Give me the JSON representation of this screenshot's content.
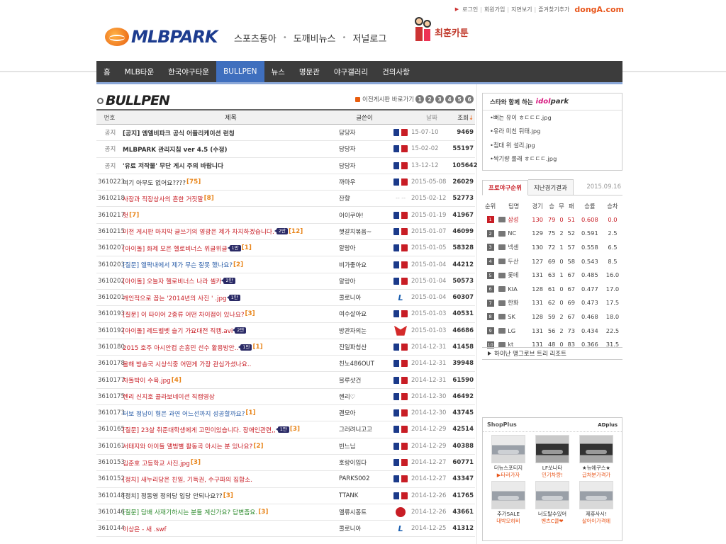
{
  "top_links": {
    "items": [
      "로그인",
      "회원가입",
      "지면보기",
      "즐겨찾기추가"
    ],
    "brand": "dongA.com"
  },
  "header": {
    "logo": "MLBPARK",
    "site_nav": [
      "스포츠동아",
      "도깨비뉴스",
      "저널로그"
    ],
    "cartoon": "최훈카툰"
  },
  "main_nav": {
    "items": [
      "홈",
      "MLB타운",
      "한국야구타운",
      "BULLPEN",
      "뉴스",
      "명문관",
      "야구갤러리",
      "건의사항"
    ],
    "active": "BULLPEN"
  },
  "board": {
    "title": "BULLPEN",
    "prev_label": "이전게시판 바로가기",
    "pages": [
      "1",
      "2",
      "3",
      "4",
      "5",
      "6"
    ],
    "columns": {
      "num": "번호",
      "title": "제목",
      "writer": "글쓴이",
      "date": "날짜",
      "views": "조회"
    },
    "rows": [
      {
        "num": "공지",
        "title": "[공지] 엠엘비파크 공식 어플리케이션 런칭",
        "comments": "",
        "tag": "",
        "writer": "담당자",
        "team": "mlb",
        "date": "15-07-10",
        "views": "9469",
        "color": "dark",
        "notice": true
      },
      {
        "num": "공지",
        "title": "MLBPARK 관리지침 ver 4.5 (수정)",
        "comments": "",
        "tag": "",
        "writer": "담당자",
        "team": "mlb",
        "date": "15-02-02",
        "views": "55197",
        "color": "dark",
        "notice": true
      },
      {
        "num": "공지",
        "title": "'유료 저작물' 무단 게시 주의 바랍니다",
        "comments": "",
        "tag": "",
        "writer": "담당자",
        "team": "mlb",
        "date": "13-12-12",
        "views": "105642",
        "color": "dark",
        "notice": true
      },
      {
        "num": "3610223",
        "title": "여기 아무도 없어요????",
        "comments": "[75]",
        "tag": "",
        "writer": "까마우",
        "team": "mlb",
        "date": "2015-05-08",
        "views": "26029",
        "color": "dark",
        "notice": false
      },
      {
        "num": "3610218",
        "title": "사장과 직장상사의 흔한 거짓말",
        "comments": "[8]",
        "tag": "",
        "writer": "잔향",
        "team": "none",
        "date": "2015-02-12",
        "views": "52773",
        "color": "red",
        "notice": false
      },
      {
        "num": "3610217",
        "title": "헛",
        "comments": "[7]",
        "tag": "",
        "writer": "어이쿠야!",
        "team": "mlb",
        "date": "2015-01-19",
        "views": "41967",
        "color": "red",
        "notice": false
      },
      {
        "num": "3610215",
        "title": "이전 게시판 마지막 글쓰기의 영광은 제가 차지하겠습니다.",
        "comments": "[12]",
        "tag": "2만",
        "writer": "햇갈치볶음~",
        "team": "mlb",
        "date": "2015-01-07",
        "views": "46099",
        "color": "red",
        "notice": false
      },
      {
        "num": "3610207",
        "title": "[아이돌] 화제 모은 헬로비너스 위글위글",
        "comments": "[1]",
        "tag": "1만",
        "writer": "알랑아",
        "team": "mlb",
        "date": "2015-01-05",
        "views": "58328",
        "color": "red",
        "notice": false
      },
      {
        "num": "3610203",
        "title": "[질문] 앨팍내에서 제가 무슨 잘못 했나요?",
        "comments": "[2]",
        "tag": "",
        "writer": "비가좋아요",
        "team": "mlb",
        "date": "2015-01-04",
        "views": "44212",
        "color": "blue",
        "notice": false
      },
      {
        "num": "3610202",
        "title": "[아이돌] 오늘자 헬로비너스 나라 셀카",
        "comments": "",
        "tag": "2만",
        "writer": "알랑아",
        "team": "mlb",
        "date": "2015-01-04",
        "views": "50573",
        "color": "red",
        "notice": false
      },
      {
        "num": "3610201",
        "title": "개인적으로 꼽는 '2014년의 사진 ' .jpg",
        "comments": "",
        "tag": "1만",
        "writer": "콜로니아",
        "team": "la",
        "date": "2015-01-04",
        "views": "60307",
        "color": "red",
        "notice": false
      },
      {
        "num": "3610193",
        "title": "[질문] 이 타이어 2종류 어떤 차이점이 있나요?",
        "comments": "[3]",
        "tag": "",
        "writer": "여수살아요",
        "team": "mlb",
        "date": "2015-01-03",
        "views": "40531",
        "color": "red",
        "notice": false
      },
      {
        "num": "3610192",
        "title": "[아이돌] 레드벨벳 슬기 가요대전 직캠.avi",
        "comments": "",
        "tag": "2만",
        "writer": "방관자의눈",
        "team": "kbo",
        "date": "2015-01-03",
        "views": "46686",
        "color": "red",
        "notice": false
      },
      {
        "num": "3610180",
        "title": "2015 호주 아시안컵 손흥민 선수 활용방안..",
        "comments": "[1]",
        "tag": "1만",
        "writer": "진일파청산",
        "team": "mlb",
        "date": "2014-12-31",
        "views": "41458",
        "color": "red",
        "notice": false
      },
      {
        "num": "3610178",
        "title": "올해 방송국 시상식중 어떤게 가장 관심가셨나요..",
        "comments": "",
        "tag": "",
        "writer": "친노486OUT",
        "team": "mlb",
        "date": "2014-12-31",
        "views": "39948",
        "color": "red",
        "notice": false
      },
      {
        "num": "3610177",
        "title": "차돌박이 수육.jpg",
        "comments": "[4]",
        "tag": "",
        "writer": "블루샷건",
        "team": "mlb",
        "date": "2014-12-31",
        "views": "61590",
        "color": "red",
        "notice": false
      },
      {
        "num": "3610175",
        "title": "헨리 신지호 콜라보네이션 직캠영상",
        "comments": "",
        "tag": "",
        "writer": "헨리♡",
        "team": "mlb",
        "date": "2014-12-30",
        "views": "46492",
        "color": "red",
        "notice": false
      },
      {
        "num": "3610173",
        "title": "터보 정남이 형은 과연 어느선까지 성공할까요?",
        "comments": "[1]",
        "tag": "",
        "writer": "괜모아",
        "team": "mlb",
        "date": "2014-12-30",
        "views": "43745",
        "color": "blue",
        "notice": false
      },
      {
        "num": "3610165",
        "title": "[질문] 23살 취준대학생에게 고민이있습니다. 장애인관련,,",
        "comments": "[3]",
        "tag": "1만",
        "writer": "그러려니고고",
        "team": "mlb",
        "date": "2014-12-29",
        "views": "42514",
        "color": "red",
        "notice": false
      },
      {
        "num": "3610161",
        "title": "서태지와 아이들 앨범별 활동곡 아시는 분 있나요?",
        "comments": "[2]",
        "tag": "",
        "writer": "빈느님",
        "team": "mlb",
        "date": "2014-12-29",
        "views": "40388",
        "color": "red",
        "notice": false
      },
      {
        "num": "3610153",
        "title": "김준호 고등학교 사진.jpg",
        "comments": "[3]",
        "tag": "",
        "writer": "호랑이임다",
        "team": "mlb",
        "date": "2014-12-27",
        "views": "60771",
        "color": "red",
        "notice": false
      },
      {
        "num": "3610152",
        "title": "[정치] 새누리당은 친일, 기득권, 수구파의 집합소.",
        "comments": "",
        "tag": "",
        "writer": "PARKS002",
        "team": "mlb",
        "date": "2014-12-27",
        "views": "43347",
        "color": "red",
        "notice": false
      },
      {
        "num": "3610148",
        "title": "[정치] 정동영 정의당 입당 안되나요??",
        "comments": "[3]",
        "tag": "",
        "writer": "TTANK",
        "team": "mlb",
        "date": "2014-12-26",
        "views": "41765",
        "color": "dark",
        "notice": false
      },
      {
        "num": "3610146",
        "title": "[질문] 담배 사재기하시는 분들 계신가요? 답변좀요.",
        "comments": "[3]",
        "tag": "",
        "writer": "엘류시퐁트",
        "team": "cle",
        "date": "2014-12-26",
        "views": "43661",
        "color": "green",
        "notice": false
      },
      {
        "num": "3610144",
        "title": "이상은 - 새 .swf",
        "comments": "",
        "tag": "",
        "writer": "콜로니아",
        "team": "la",
        "date": "2014-12-25",
        "views": "41312",
        "color": "red",
        "notice": false
      }
    ]
  },
  "idol": {
    "header_prefix": "스타와 함께 하는",
    "brand_a": "idol",
    "brand_b": "park",
    "items": [
      "•뻐는 유이 ㅎㄷㄷㄷ.jpg",
      "•유라 미친 뒤태.jpg",
      "•침대 위 설리.jpg",
      "•싹기량 롤래 ㅎㄷㄷㄷ.jpg"
    ]
  },
  "ranking": {
    "tab_active": "프로야구순위",
    "tab_other": "지난경기결과",
    "date": "2015.09.16",
    "headers": [
      "순위",
      "팀명",
      "경기",
      "승",
      "무",
      "패",
      "승률",
      "승차"
    ],
    "rows": [
      {
        "rank": "1",
        "team": "삼성",
        "g": "130",
        "w": "79",
        "d": "0",
        "l": "51",
        "pct": "0.608",
        "gb": "0.0"
      },
      {
        "rank": "2",
        "team": "NC",
        "g": "129",
        "w": "75",
        "d": "2",
        "l": "52",
        "pct": "0.591",
        "gb": "2.5"
      },
      {
        "rank": "3",
        "team": "넥센",
        "g": "130",
        "w": "72",
        "d": "1",
        "l": "57",
        "pct": "0.558",
        "gb": "6.5"
      },
      {
        "rank": "4",
        "team": "두산",
        "g": "127",
        "w": "69",
        "d": "0",
        "l": "58",
        "pct": "0.543",
        "gb": "8.5"
      },
      {
        "rank": "5",
        "team": "롯데",
        "g": "131",
        "w": "63",
        "d": "1",
        "l": "67",
        "pct": "0.485",
        "gb": "16.0"
      },
      {
        "rank": "6",
        "team": "KIA",
        "g": "128",
        "w": "61",
        "d": "0",
        "l": "67",
        "pct": "0.477",
        "gb": "17.0"
      },
      {
        "rank": "7",
        "team": "한화",
        "g": "131",
        "w": "62",
        "d": "0",
        "l": "69",
        "pct": "0.473",
        "gb": "17.5"
      },
      {
        "rank": "8",
        "team": "SK",
        "g": "128",
        "w": "59",
        "d": "2",
        "l": "67",
        "pct": "0.468",
        "gb": "18.0"
      },
      {
        "rank": "9",
        "team": "LG",
        "g": "131",
        "w": "56",
        "d": "2",
        "l": "73",
        "pct": "0.434",
        "gb": "22.5"
      },
      {
        "rank": "10",
        "team": "kt",
        "g": "131",
        "w": "48",
        "d": "0",
        "l": "83",
        "pct": "0.366",
        "gb": "31.5"
      }
    ]
  },
  "banner": {
    "text": "하이난 맹그로브 트리 리조트"
  },
  "shop": {
    "title": "ShopPlus",
    "title_accent": "+",
    "ad": "ADplus",
    "items": [
      {
        "name": "더뉴스포티지",
        "sub": "▶타러가자",
        "dark": false
      },
      {
        "name": "LF쏘나타",
        "sub": "인기차량!",
        "dark": true
      },
      {
        "name": "★뉴에쿠스★",
        "sub": "급처분가격가",
        "dark": true
      },
      {
        "name": "추가SALE",
        "sub": "대박모하비",
        "dark": false
      },
      {
        "name": "너도탈수있어",
        "sub": "벤츠C클❤",
        "dark": false
      },
      {
        "name": "제휴사시!",
        "sub": "살아이가격에",
        "dark": false
      }
    ]
  },
  "colors": {
    "nav_bg": "#3c3c3c",
    "nav_active": "#3f6fbe",
    "red": "#c81d25",
    "blue": "#2b5ea8",
    "orange": "#e8851a"
  }
}
